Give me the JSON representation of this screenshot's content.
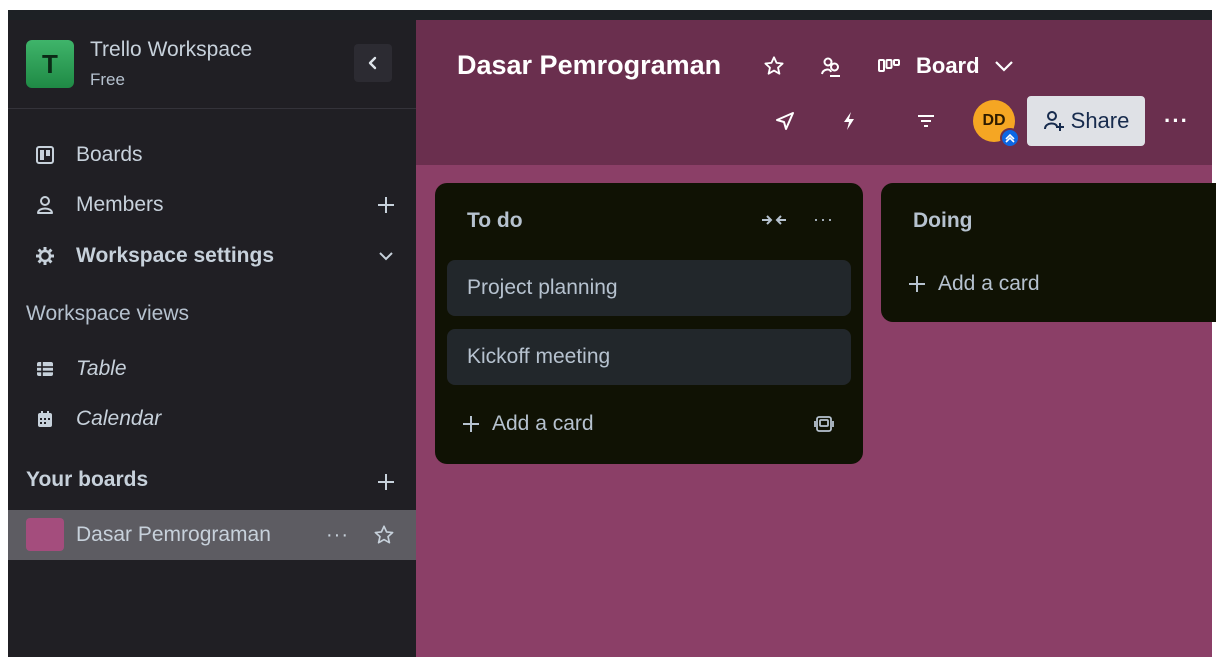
{
  "workspace": {
    "logo_letter": "T",
    "name": "Trello Workspace",
    "plan": "Free"
  },
  "sidebar": {
    "items": [
      {
        "label": "Boards",
        "icon": "board-icon"
      },
      {
        "label": "Members",
        "icon": "person-icon"
      },
      {
        "label": "Workspace settings",
        "icon": "gear-icon"
      }
    ],
    "workspace_views_heading": "Workspace views",
    "views": [
      {
        "label": "Table",
        "icon": "table-icon"
      },
      {
        "label": "Calendar",
        "icon": "calendar-icon"
      }
    ],
    "your_boards_heading": "Your boards",
    "boards": [
      {
        "name": "Dasar Pemrograman",
        "color": "#a44d7d"
      }
    ],
    "board_more": "···"
  },
  "board": {
    "title": "Dasar Pemrograman",
    "view": "Board",
    "avatar_initials": "DD",
    "share_label": "Share",
    "more": "···",
    "background": "#8b3f67",
    "header_background": "#6a2f4e"
  },
  "lists": [
    {
      "title": "To do",
      "cards": [
        "Project planning",
        "Kickoff meeting"
      ],
      "add_card": "Add a card"
    },
    {
      "title": "Doing",
      "cards": [],
      "add_card": "Add a card"
    }
  ],
  "list_more": "···"
}
